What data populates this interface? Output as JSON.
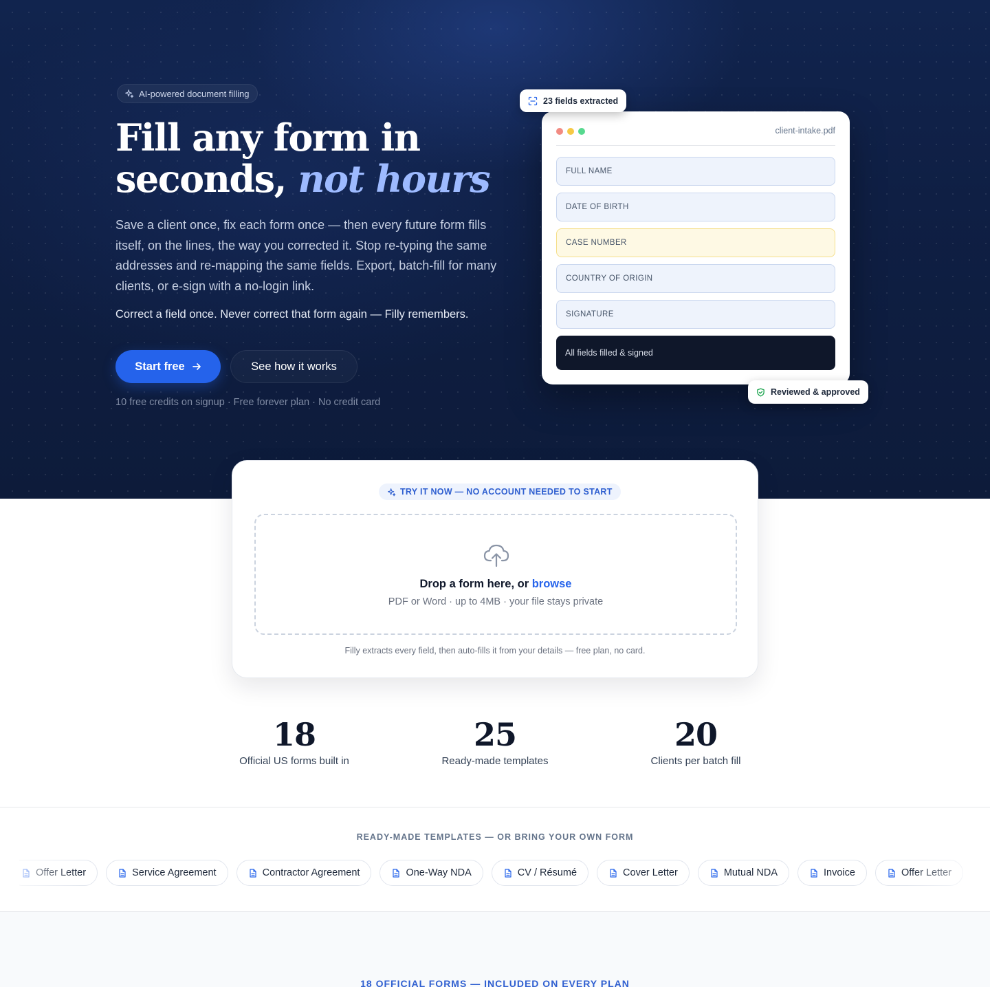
{
  "hero": {
    "badge": "AI-powered document filling",
    "title_line1": "Fill any form in",
    "title_line2": "seconds,",
    "title_accent": "not hours",
    "lead": "Save a client once, fix each form once — then every future form fills itself, on the lines, the way you corrected it. Stop re-typing the same addresses and re-mapping the same fields. Export, batch-fill for many clients, or e-sign with a no-login link.",
    "lead2": "Correct a field once. Never correct that form again — Filly remembers.",
    "cta_primary": "Start free",
    "cta_secondary": "See how it works",
    "fine_print": "10 free credits on signup · Free forever plan · No credit card"
  },
  "preview": {
    "extracted_badge": "23 fields extracted",
    "filename": "client-intake.pdf",
    "fields": [
      "FULL NAME",
      "DATE OF BIRTH",
      "CASE NUMBER",
      "COUNTRY OF ORIGIN",
      "SIGNATURE"
    ],
    "done_label": "All fields filled & signed",
    "reviewed_badge": "Reviewed & approved",
    "window_dot_colors": [
      "#f28b82",
      "#f6c945",
      "#57d98f"
    ],
    "highlight_color": "#fef9e4"
  },
  "upload": {
    "pill": "TRY IT NOW — NO ACCOUNT NEEDED TO START",
    "drop_title": "Drop a form here, or",
    "browse": "browse",
    "drop_sub": "PDF or Word · up to 4MB · your file stays private",
    "footnote": "Filly extracts every field, then auto-fills it from your details — free plan, no card."
  },
  "stats": [
    {
      "value": "18",
      "label": "Official US forms built in"
    },
    {
      "value": "25",
      "label": "Ready-made templates"
    },
    {
      "value": "20",
      "label": "Clients per batch fill"
    }
  ],
  "templates": {
    "heading": "READY-MADE TEMPLATES — OR BRING YOUR OWN FORM",
    "items": [
      "Offer Letter",
      "Service Agreement",
      "Contractor Agreement",
      "One-Way NDA",
      "CV / Résumé",
      "Cover Letter",
      "Mutual NDA",
      "Invoice",
      "Offer Letter"
    ]
  },
  "official": {
    "heading": "18 OFFICIAL FORMS — INCLUDED ON EVERY PLAN"
  },
  "colors": {
    "accent": "#2563eb",
    "hero_bg": "#0f1f44",
    "accent_italic": "#9dbaff"
  }
}
